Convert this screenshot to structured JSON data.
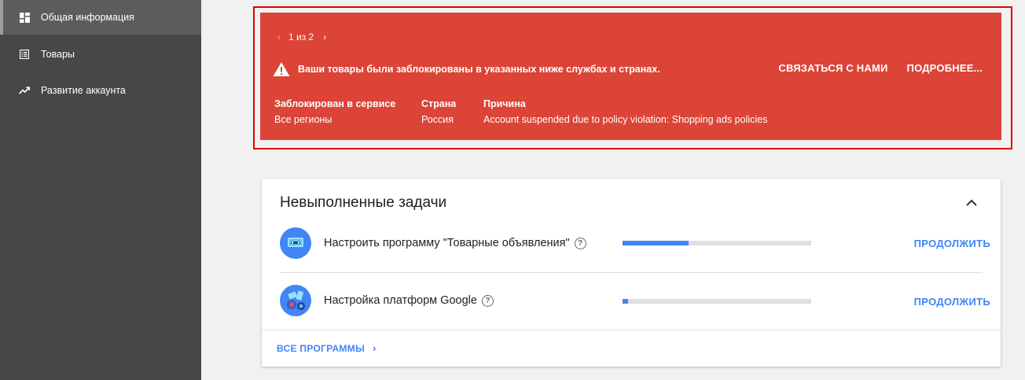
{
  "sidebar": {
    "items": [
      {
        "label": "Общая информация",
        "icon": "dashboard-icon",
        "active": true
      },
      {
        "label": "Товары",
        "icon": "list-icon",
        "active": false
      },
      {
        "label": "Развитие аккаунта",
        "icon": "trending-up-icon",
        "active": false
      }
    ]
  },
  "alert": {
    "pager": {
      "text": "1 из 2"
    },
    "message": "Ваши товары были заблокированы в указанных ниже службах и странах.",
    "actions": {
      "contact": "СВЯЗАТЬСЯ С НАМИ",
      "more": "ПОДРОБНЕЕ..."
    },
    "table": {
      "headers": [
        "Заблокирован в сервисе",
        "Страна",
        "Причина"
      ],
      "values": [
        "Все регионы",
        "Россия",
        "Account suspended due to policy violation: Shopping ads policies"
      ]
    },
    "colors": {
      "background": "#db4437",
      "outline": "#e50000"
    }
  },
  "tasks_card": {
    "title": "Невыполненные задачи",
    "tasks": [
      {
        "label": "Настроить программу \"Товарные объявления\"",
        "progress": 0.35,
        "action": "ПРОДОЛЖИТЬ"
      },
      {
        "label": "Настройка платформ Google",
        "progress": 0.03,
        "action": "ПРОДОЛЖИТЬ"
      }
    ],
    "all_programs": "ВСЕ ПРОГРАММЫ",
    "colors": {
      "accent": "#4285f4"
    }
  }
}
